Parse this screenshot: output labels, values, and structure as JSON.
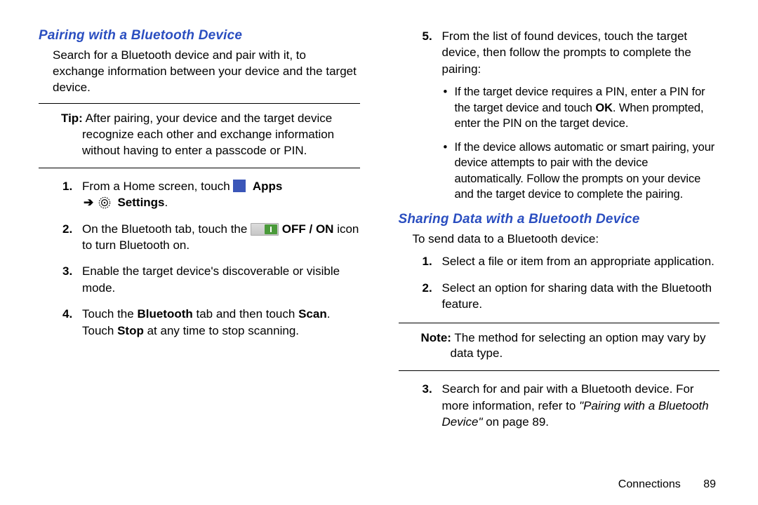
{
  "left": {
    "heading": "Pairing with a Bluetooth Device",
    "intro": "Search for a Bluetooth device and pair with it, to exchange information between your device and the target device.",
    "tip_label": "Tip:",
    "tip_text": "After pairing, your device and the target device recognize each other and exchange information without having to enter a passcode or PIN.",
    "steps": {
      "s1_a": "From a Home screen, touch ",
      "s1_apps": "Apps",
      "s1_arrow": "➔",
      "s1_settings": "Settings",
      "s1_period": ".",
      "s2_a": "On the Bluetooth tab, touch the ",
      "s2_b": " OFF / ON",
      "s2_c": " icon to turn Bluetooth on.",
      "s3": "Enable the target device's discoverable or visible mode.",
      "s4_a": "Touch the ",
      "s4_b": "Bluetooth",
      "s4_c": " tab and then touch ",
      "s4_d": "Scan",
      "s4_e": ". Touch ",
      "s4_f": "Stop",
      "s4_g": " at any time to stop scanning."
    }
  },
  "right": {
    "step5": "From the list of found devices, touch the target device, then follow the prompts to complete the pairing:",
    "sub1_a": "If the target device requires a PIN, enter a PIN for the target device and touch ",
    "sub1_b": "OK",
    "sub1_c": ". When prompted, enter the PIN on the target device.",
    "sub2": "If the device allows automatic or smart pairing, your device attempts to pair with the device automatically. Follow the prompts on your device and the target device to complete the pairing.",
    "heading2": "Sharing Data with a Bluetooth Device",
    "intro2": "To send data to a Bluetooth device:",
    "share1": "Select a file or item from an appropriate application.",
    "share2": "Select an option for sharing data with the Bluetooth feature.",
    "note_label": "Note:",
    "note_text": "The method for selecting an option may vary by data type.",
    "share3_a": "Search for and pair with a Bluetooth device. For more information, refer to ",
    "share3_b": "\"Pairing with a Bluetooth Device\"",
    "share3_c": " on page 89."
  },
  "footer": {
    "section": "Connections",
    "page": "89"
  },
  "nums": {
    "n1": "1.",
    "n2": "2.",
    "n3": "3.",
    "n4": "4.",
    "n5": "5."
  }
}
